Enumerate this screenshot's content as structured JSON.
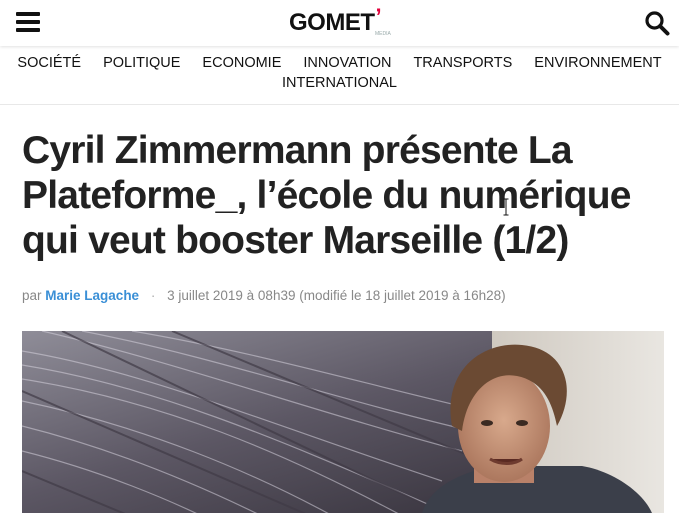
{
  "header": {
    "logo_text": "GOMET",
    "logo_accent": "’",
    "logo_sub": "MEDIA",
    "menu_icon": "hamburger-menu-icon",
    "search_icon": "search-icon"
  },
  "nav": {
    "row1": [
      "SOCIÉTÉ",
      "POLITIQUE",
      "ECONOMIE",
      "INNOVATION",
      "TRANSPORTS",
      "ENVIRONNEMENT"
    ],
    "row2": [
      "INTERNATIONAL"
    ]
  },
  "article": {
    "title": "Cyril Zimmermann présente La Plateforme_, l’école du numérique qui veut booster Marseille (1/2)",
    "by_prefix": "par",
    "author": "Marie Lagache",
    "separator": "·",
    "date_text": "3 juillet 2019 à 08h39 (modifié le 18 juillet 2019 à 16h28)"
  },
  "colors": {
    "accent": "#e2003b",
    "author_link": "#3a8fd6",
    "title_text": "#222222",
    "meta_text": "#888888"
  }
}
